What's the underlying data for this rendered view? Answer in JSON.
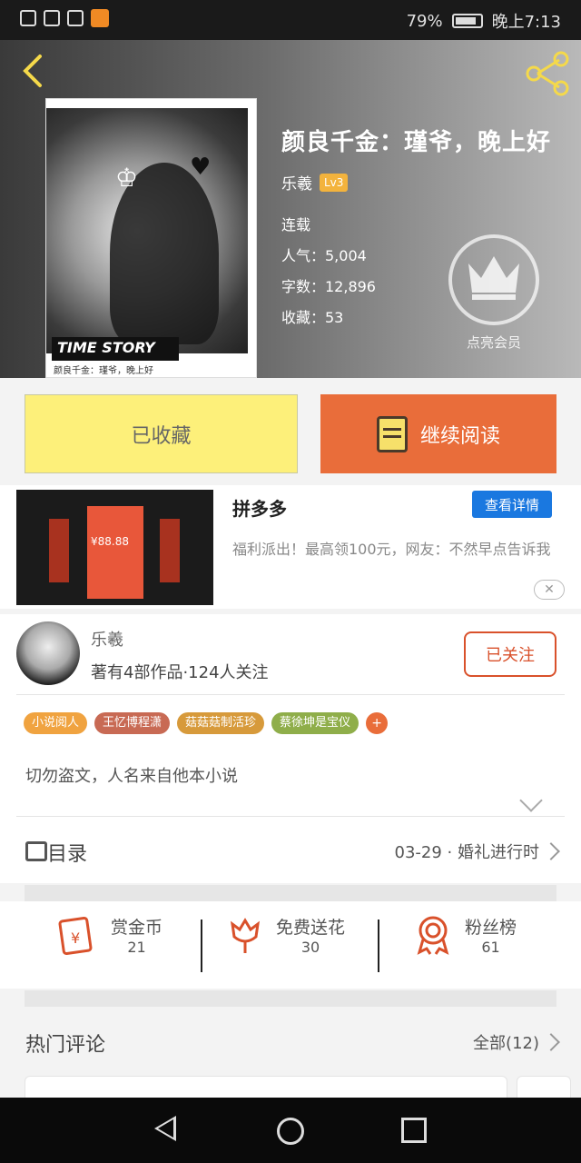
{
  "status_bar": {
    "battery_pct": "79%",
    "time": "晚上7:13"
  },
  "book": {
    "title": "颜良千金：瑾爷，晚上好",
    "author": "乐羲",
    "author_level": "Lv3",
    "status": "连载",
    "popularity": "人气：5,004",
    "word_count": "字数：12,896",
    "favorites": "收藏：53",
    "cover_text": "TIME STORY",
    "cover_caption": "颜良千金：瑾爷，晚上好",
    "vip_label": "点亮会员"
  },
  "buttons": {
    "favorited": "已收藏",
    "continue_reading": "继续阅读"
  },
  "ad": {
    "title": "拼多多",
    "detail_button": "查看详情",
    "description": "福利派出！最高领100元，网友：不然早点告诉我",
    "close": "✕",
    "amount": "¥88.88"
  },
  "author_card": {
    "name": "乐羲",
    "stats": "著有4部作品·124人关注",
    "follow": "已关注",
    "tags": [
      {
        "label": "小说阅人",
        "color": "#f0a340"
      },
      {
        "label": "王忆博程潇",
        "color": "#c86a54"
      },
      {
        "label": "菇菇菇制活珍",
        "color": "#d79a3b"
      },
      {
        "label": "蔡徐坤是宝仪",
        "color": "#8fae4a"
      }
    ],
    "add_tag": "+",
    "intro": "切勿盗文，人名来自他本小说"
  },
  "toc": {
    "label": "目录",
    "latest": "03-29 · 婚礼进行时"
  },
  "actions": [
    {
      "label": "赏金币",
      "count": "21",
      "icon": "red-envelope-icon"
    },
    {
      "label": "免费送花",
      "count": "30",
      "icon": "flower-icon"
    },
    {
      "label": "粉丝榜",
      "count": "61",
      "icon": "medal-icon"
    }
  ],
  "hot_comments": {
    "label": "热门评论",
    "all": "全部(12)"
  }
}
